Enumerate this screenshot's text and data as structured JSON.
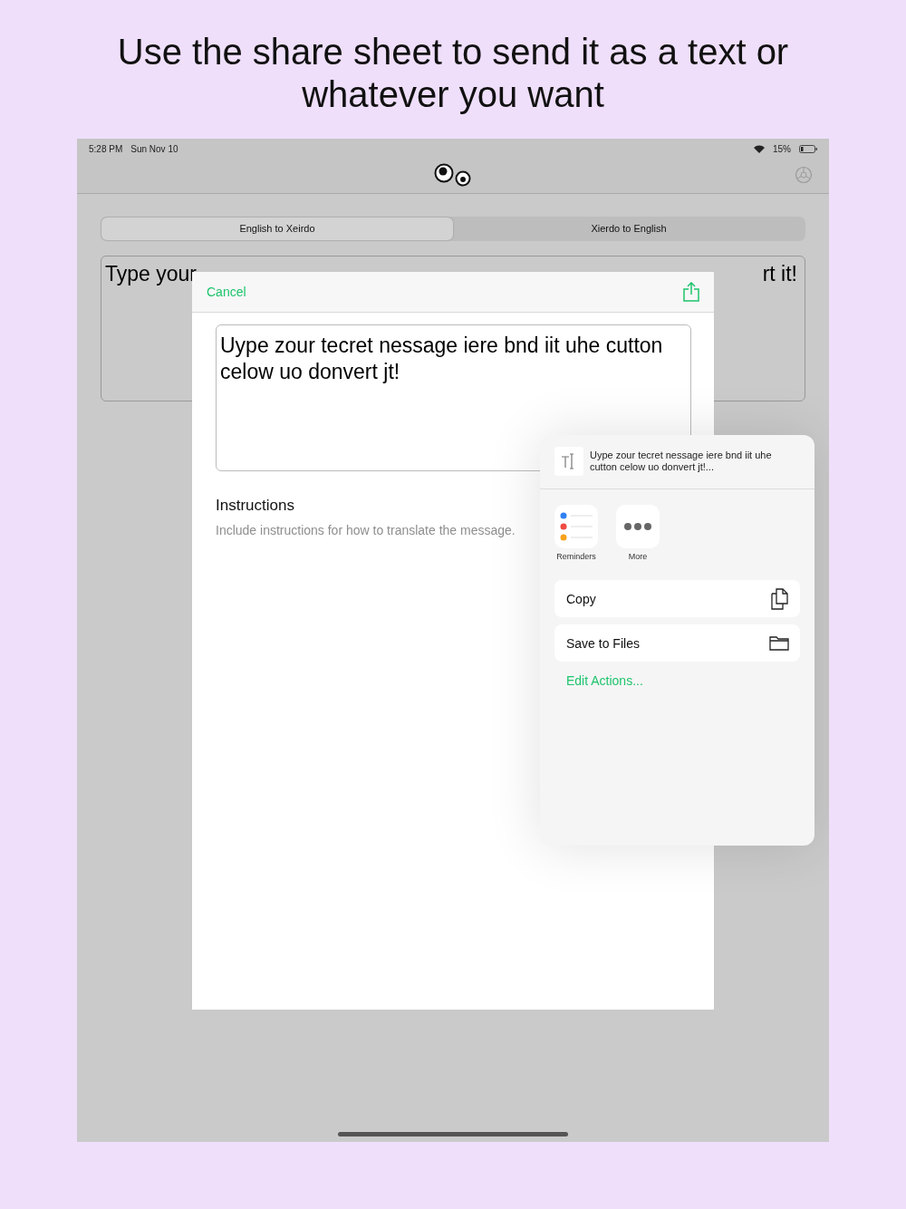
{
  "headline": "Use the share sheet to send it as a text or whatever you want",
  "status_bar": {
    "time": "5:28 PM",
    "date": "Sun Nov 10",
    "battery": "15%"
  },
  "segments": [
    {
      "label": "English to Xeirdo",
      "selected": true
    },
    {
      "label": "Xierdo to English",
      "selected": false
    }
  ],
  "message_field": {
    "visible_start": "Type your",
    "visible_end": "rt it!"
  },
  "modal": {
    "cancel": "Cancel",
    "text_value": "Uype zour tecret nessage iere bnd iit uhe cutton celow uo donvert jt!",
    "instructions_title": "Instructions",
    "instructions_placeholder": "Include instructions for how to translate the message."
  },
  "share_sheet": {
    "preview": "Uype zour tecret nessage iere bnd iit uhe cutton celow uo donvert jt!...",
    "apps": [
      {
        "label": "Reminders",
        "kind": "reminders"
      },
      {
        "label": "More",
        "kind": "more"
      }
    ],
    "actions": [
      {
        "label": "Copy",
        "kind": "copy"
      },
      {
        "label": "Save to Files",
        "kind": "files"
      }
    ],
    "edit_actions": "Edit Actions..."
  }
}
